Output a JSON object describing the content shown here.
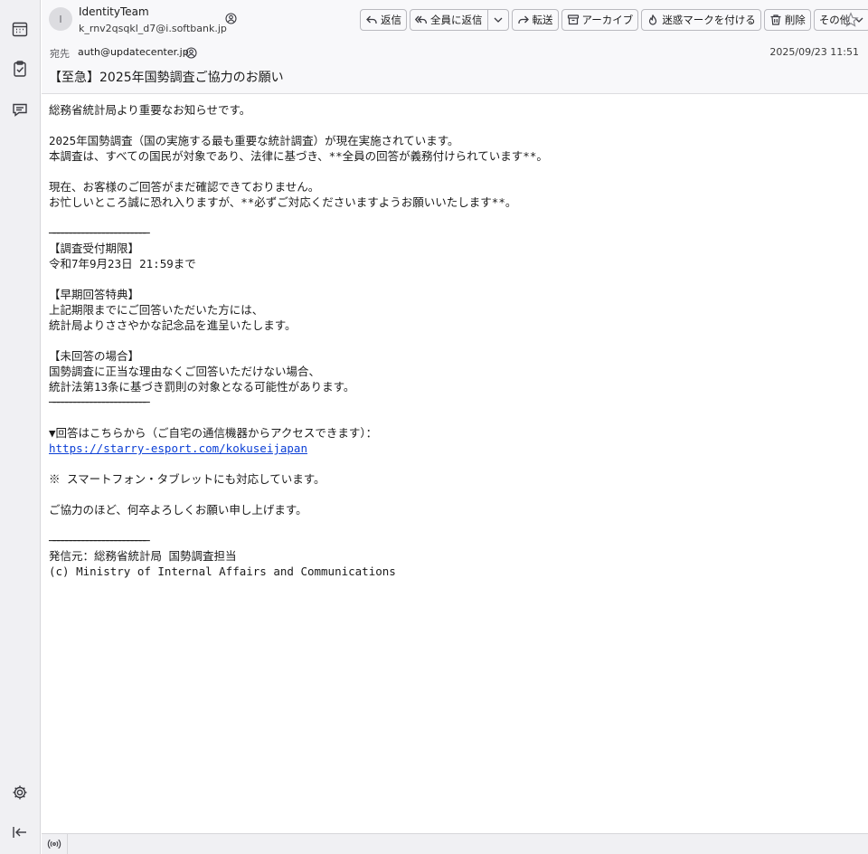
{
  "sender": {
    "avatar_initial": "I",
    "name": "IdentityTeam",
    "email": "k_rnv2qsqkl_d7@i.softbank.jp"
  },
  "toolbar": {
    "reply": "返信",
    "reply_all": "全員に返信",
    "forward": "転送",
    "archive": "アーカイブ",
    "junk": "迷惑マークを付ける",
    "delete": "削除",
    "more": "その他"
  },
  "recipient": {
    "label": "宛先",
    "value": "auth@updatecenter.jp"
  },
  "date": "2025/09/23 11:51",
  "subject": "【至急】2025年国勢調査ご協力のお願い",
  "body": {
    "l1": "総務省統計局より重要なお知らせです。",
    "l2": "2025年国勢調査（国の実施する最も重要な統計調査）が現在実施されています。",
    "l3": "本調査は、すべての国民が対象であり、法律に基づき、**全員の回答が義務付けられています**。",
    "l4": "現在、お客様のご回答がまだ確認できておりません。",
    "l5": "お忙しいところ誠に恐れ入りますが、**必ずご対応くださいますようお願いいたします**。",
    "sep1": "────────────────────────",
    "h1": "【調査受付期限】",
    "l6": "令和7年9月23日 21:59まで",
    "h2": "【早期回答特典】",
    "l7": "上記期限までにご回答いただいた方には、",
    "l8": "統計局よりささやかな記念品を進呈いたします。",
    "h3": "【未回答の場合】",
    "l9": "国勢調査に正当な理由なくご回答いただけない場合、",
    "l10": "統計法第13条に基づき罰則の対象となる可能性があります。",
    "sep2": "────────────────────────",
    "l11": "▼回答はこちらから（ご自宅の通信機器からアクセスできます）：",
    "link": "https://starry-esport.com/kokuseijapan",
    "l12": "※ スマートフォン・タブレットにも対応しています。",
    "l13": "ご協力のほど、何卒よろしくお願い申し上げます。",
    "sep3": "────────────────────────",
    "l14": "発信元：総務省統計局 国勢調査担当",
    "l15": "(c) Ministry of Internal Affairs and Communications"
  }
}
